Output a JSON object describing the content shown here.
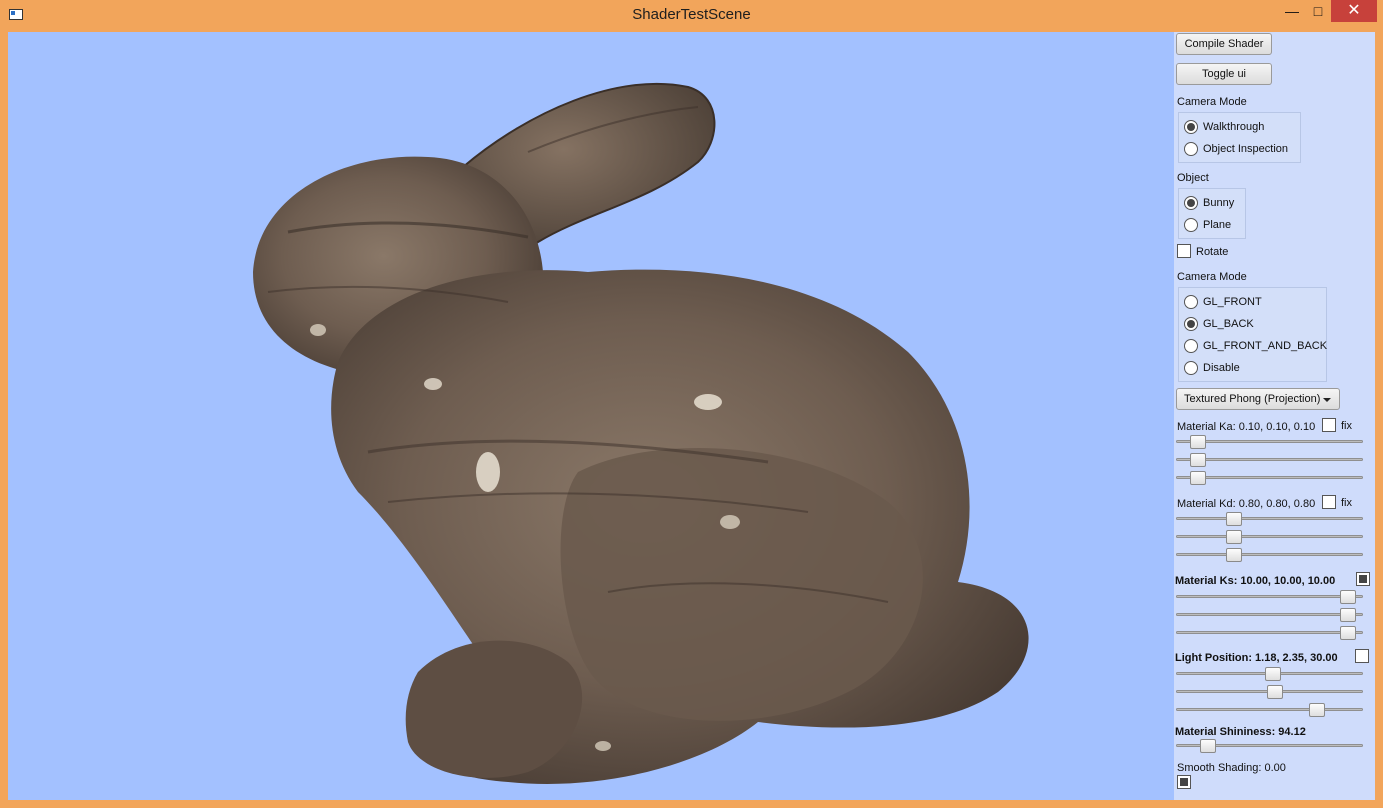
{
  "window": {
    "title": "ShaderTestScene",
    "minimize_glyph": "—",
    "maximize_glyph": "□",
    "close_glyph": "✕"
  },
  "viewport": {
    "background_color": "#a3c1ff",
    "object": "bunny-icon"
  },
  "panel": {
    "compile_button": "Compile Shader",
    "toggle_button": "Toggle ui",
    "camera_mode_label": "Camera Mode",
    "camera_options": [
      {
        "label": "Walkthrough",
        "selected": true
      },
      {
        "label": "Object Inspection",
        "selected": false
      }
    ],
    "object_label": "Object",
    "object_options": [
      {
        "label": "Bunny",
        "selected": true
      },
      {
        "label": "Plane",
        "selected": false
      }
    ],
    "rotate_label": "Rotate",
    "rotate_checked": false,
    "cull_label": "Camera Mode",
    "cull_options": [
      {
        "label": "GL_FRONT",
        "selected": false
      },
      {
        "label": "GL_BACK",
        "selected": true
      },
      {
        "label": "GL_FRONT_AND_BACK",
        "selected": false
      },
      {
        "label": "Disable",
        "selected": false
      }
    ],
    "shader_select": "Textured Phong (Projection)",
    "fix_label": "fix",
    "material_ka": {
      "label": "Material Ka: 0.10, 0.10, 0.10",
      "fixed": false,
      "values": [
        0.1,
        0.1,
        0.1
      ]
    },
    "material_kd": {
      "label": "Material Kd: 0.80, 0.80, 0.80",
      "fixed": false,
      "values": [
        0.8,
        0.8,
        0.8
      ]
    },
    "material_ks": {
      "label": "Material Ks: 10.00, 10.00, 10.00",
      "fixed": true,
      "values": [
        10.0,
        10.0,
        10.0
      ]
    },
    "light_position": {
      "label": "Light Position: 1.18, 2.35, 30.00",
      "fixed": false,
      "values": [
        1.18,
        2.35,
        30.0
      ]
    },
    "shininess": {
      "label": "Material Shininess: 94.12",
      "value": 94.12
    },
    "smooth_shading": {
      "label": "Smooth Shading: 0.00",
      "checked": true
    }
  },
  "slider_levels": {
    "ka": [
      0.08,
      0.08,
      0.08
    ],
    "kd": [
      0.29,
      0.29,
      0.29
    ],
    "ks": [
      0.96,
      0.96,
      0.96
    ],
    "light": [
      0.52,
      0.53,
      0.78
    ],
    "shininess": [
      0.14
    ]
  }
}
